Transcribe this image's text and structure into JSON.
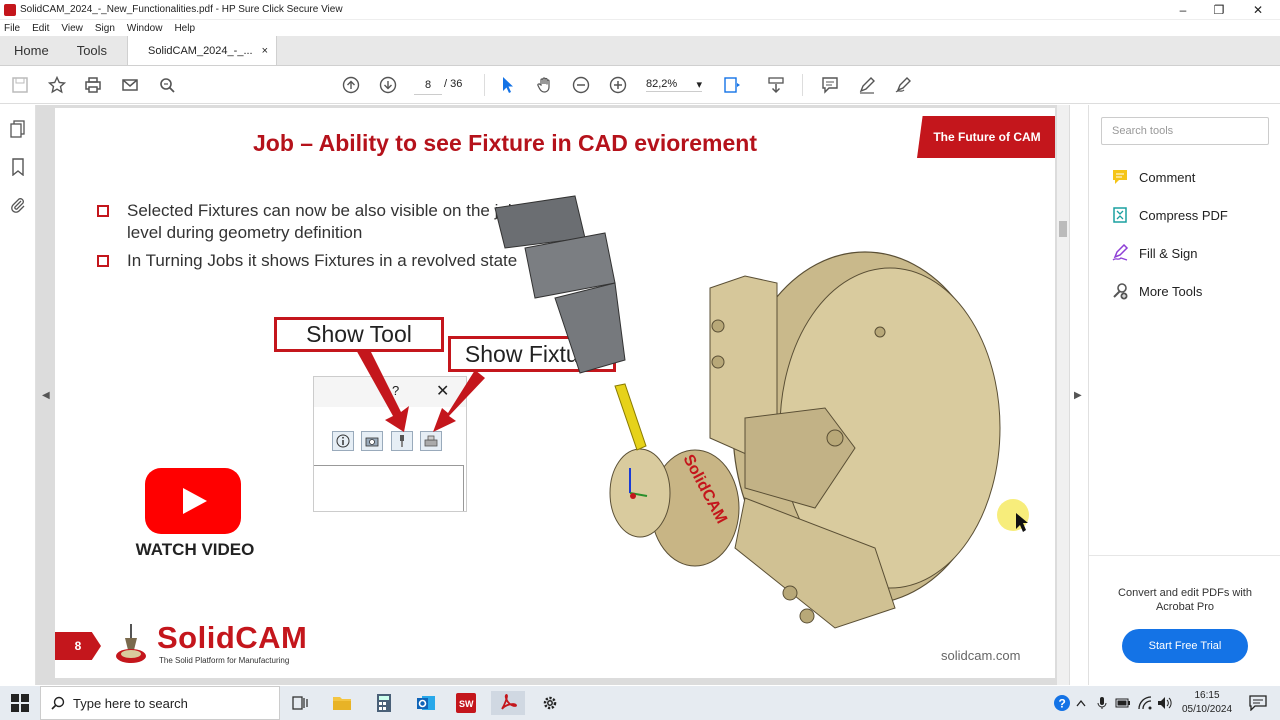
{
  "window": {
    "title": "SolidCAM_2024_-_New_Functionalities.pdf - HP Sure Click Secure View",
    "minimize": "–",
    "maximize": "❐",
    "close": "✕"
  },
  "menu": [
    "File",
    "Edit",
    "View",
    "Sign",
    "Window",
    "Help"
  ],
  "tabs": {
    "home": "Home",
    "tools": "Tools",
    "document": "SolidCAM_2024_-_...",
    "close": "×"
  },
  "toolbar": {
    "page_current": "8",
    "page_total": "/ 36",
    "zoom": "82,2%",
    "zoom_caret": "▾"
  },
  "slide": {
    "title": "Job – Ability to see Fixture in CAD eviorement",
    "brand_badge": "The Future of CAM",
    "bullets": [
      "Selected Fixtures can now be also visible on the job level during geometry definition",
      "In Turning Jobs it shows Fixtures in a revolved state"
    ],
    "callout_show_tool": "Show Tool",
    "callout_show_fixture": "Show Fixture",
    "dialog_help": "?",
    "dialog_close": "✕",
    "watch_video": "WATCH VIDEO",
    "page_number": "8",
    "logo_name": "SolidCAM",
    "logo_tagline": "The Solid Platform for Manufacturing",
    "website": "solidcam.com",
    "model_text": "SolidCAM"
  },
  "tools_panel": {
    "search_placeholder": "Search tools",
    "items": [
      "Comment",
      "Compress PDF",
      "Fill & Sign",
      "More Tools"
    ],
    "promo_text": "Convert and edit PDFs with Acrobat Pro",
    "trial_button": "Start Free Trial"
  },
  "taskbar": {
    "search_placeholder": "Type here to search",
    "time": "16:15",
    "date": "05/10/2024"
  },
  "colors": {
    "brand_red": "#c4161c",
    "acrobat_blue": "#1473e6",
    "youtube_red": "#ff0000"
  }
}
